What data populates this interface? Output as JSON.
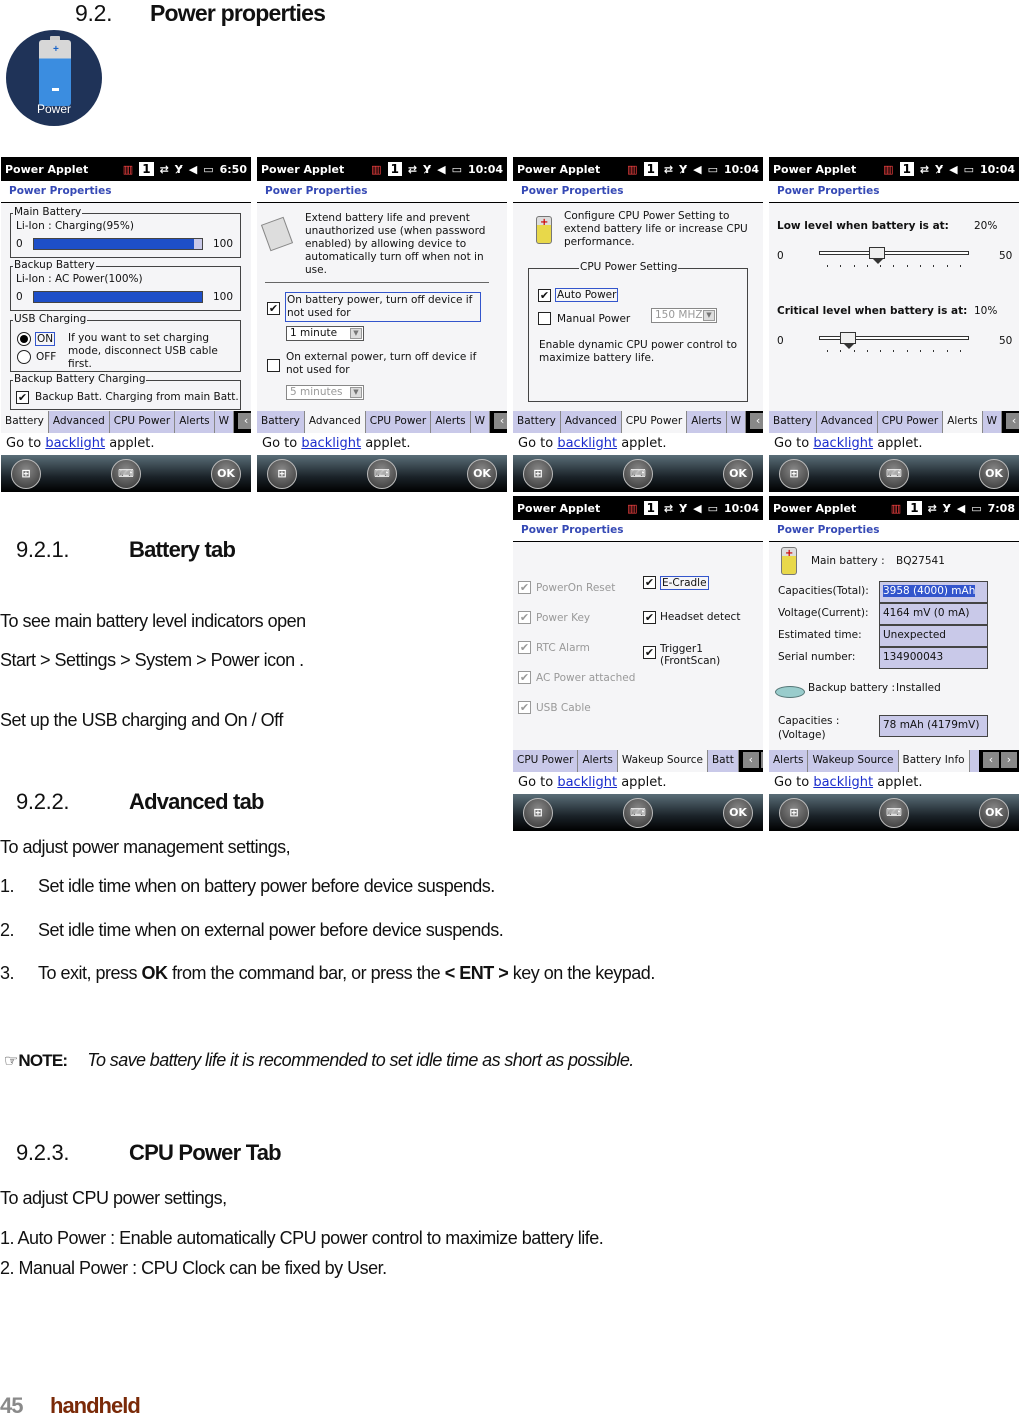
{
  "doc": {
    "section": {
      "number": "9.2.",
      "title": "Power properties"
    },
    "power_icon_label": "Power",
    "battery_tab": {
      "number": "9.2.1.",
      "title": "Battery tab",
      "p1": "To see main battery level indicators open",
      "p2": "Start > Settings > System > Power icon .",
      "p3": "Set up the USB charging and On / Off"
    },
    "advanced_tab": {
      "number": "9.2.2.",
      "title": "Advanced tab",
      "intro": "To adjust power management settings,",
      "items": [
        {
          "n": "1.",
          "text": "Set idle time when on battery power before device suspends."
        },
        {
          "n": "2.",
          "text": "Set idle time when on external power before device suspends."
        },
        {
          "n": "3.",
          "pre": "To exit, press ",
          "b1": "OK",
          "mid": " from the command bar, or press the ",
          "b2": "< ENT >",
          "post": " key on the keypad."
        }
      ],
      "note_label": "NOTE:",
      "note_text": "To save battery life it is recommended to set idle time as short as possible."
    },
    "cpu_tab": {
      "number": "9.2.3.",
      "title": "CPU Power Tab",
      "intro": "To adjust CPU power settings,",
      "l1": "1. Auto Power : Enable automatically CPU power control to maximize battery life.",
      "l2": "2. Manual Power : CPU Clock can be fixed by User."
    },
    "footer": {
      "page": "45",
      "brand": "handheld"
    }
  },
  "common": {
    "app": "Power Applet",
    "one": "1",
    "title": "Power Properties",
    "link_pre": "Go to ",
    "link": "backlight",
    "link_post": " applet.",
    "ok": "OK",
    "prev": "‹",
    "next": "›"
  },
  "screens": {
    "battery": {
      "time": "6:50",
      "tabs": [
        "Battery",
        "Advanced",
        "CPU Power",
        "Alerts",
        "W"
      ],
      "active_tab": "Battery",
      "main_label": "Main Battery",
      "main_status": "Li-Ion : Charging(95%)",
      "main_level_pct": 95,
      "backup_label": "Backup Battery",
      "backup_status": "Li-Ion : AC Power(100%)",
      "backup_level_pct": 100,
      "min": "0",
      "max": "100",
      "usb_label": "USB Charging",
      "on": "ON",
      "off": "OFF",
      "usb_selected": "ON",
      "usb_hint": "If you want to set charging mode, disconnect USB cable first.",
      "bbc_label": "Backup Battery Charging",
      "bbc_check": "Backup Batt. Charging from main Batt.",
      "bbc_checked": true
    },
    "advanced": {
      "time": "10:04",
      "tabs": [
        "Battery",
        "Advanced",
        "CPU Power",
        "Alerts",
        "W"
      ],
      "active_tab": "Advanced",
      "desc": "Extend battery life and prevent unauthorized use (when password enabled) by allowing device to automatically turn off when not in use.",
      "battery_check": "On battery power, turn off device if not used for",
      "battery_checked": true,
      "battery_value": "1 minute",
      "external_check": "On external power, turn off device if not used for",
      "external_checked": false,
      "external_value": "5 minutes"
    },
    "cpu": {
      "time": "10:04",
      "tabs": [
        "Battery",
        "Advanced",
        "CPU Power",
        "Alerts",
        "W"
      ],
      "active_tab": "CPU Power",
      "desc": "Configure CPU Power Setting to extend battery life or increase CPU performance.",
      "group": "CPU Power Setting",
      "auto": "Auto Power",
      "auto_checked": true,
      "manual": "Manual Power",
      "manual_checked": false,
      "mhz": "150 MHZ",
      "hint": "Enable dynamic CPU power control to maximize battery life."
    },
    "alerts": {
      "time": "10:04",
      "tabs": [
        "Battery",
        "Advanced",
        "CPU Power",
        "Alerts",
        "W"
      ],
      "active_tab": "Alerts",
      "low_label": "Low level when battery is at:",
      "low_value": "20%",
      "low_pct": 20,
      "crit_label": "Critical level when battery is at:",
      "crit_value": "10%",
      "crit_pct": 10,
      "min": "0",
      "max": "50",
      "range_max": 50
    },
    "wakeup": {
      "time": "10:04",
      "tabs": [
        "CPU Power",
        "Alerts",
        "Wakeup Source",
        "Batt"
      ],
      "active_tab": "Wakeup Source",
      "left": [
        "PowerOn Reset",
        "Power Key",
        "RTC Alarm",
        "AC Power attached",
        "USB Cable"
      ],
      "right": [
        "E-Cradle",
        "Headset detect",
        "Trigger1 (FrontScan)"
      ]
    },
    "info": {
      "time": "7:08",
      "tabs": [
        "Alerts",
        "Wakeup Source",
        "Battery Info"
      ],
      "active_tab": "Battery Info",
      "main_label": "Main battery :",
      "main_value": "BQ27541",
      "rows": [
        {
          "k": "Capacities(Total):",
          "v": "3958 (4000) mAh"
        },
        {
          "k": "Voltage(Current):",
          "v": "4164 mV (0 mA)"
        },
        {
          "k": "Estimated time:",
          "v": "Unexpected"
        },
        {
          "k": "Serial number:",
          "v": "134900043"
        }
      ],
      "backup_label": "Backup battery :",
      "backup_value": "Installed",
      "cap_label_1": "Capacities :",
      "cap_label_2": "(Voltage)",
      "cap_value": "78 mAh (4179mV)"
    }
  }
}
